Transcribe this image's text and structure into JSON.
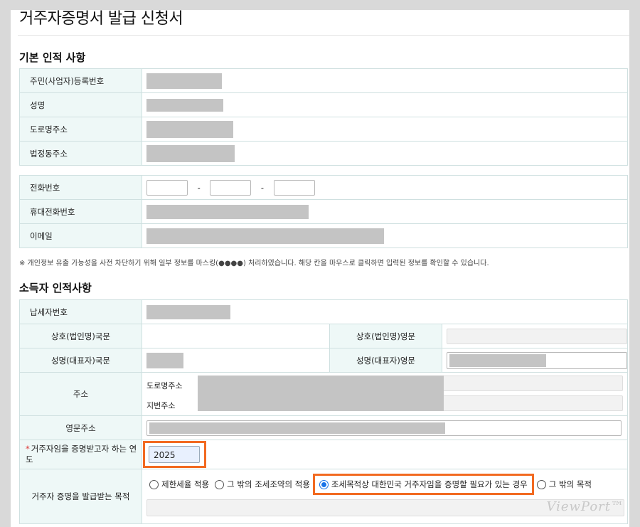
{
  "page": {
    "title": "거주자증명서 발급 신청서"
  },
  "basic_info": {
    "section_title": "기본 인적 사항",
    "fields": [
      {
        "label": "주민(사업자)등록번호"
      },
      {
        "label": "성명"
      },
      {
        "label": "도로명주소"
      },
      {
        "label": "법정동주소"
      }
    ],
    "contact": [
      {
        "label": "전화번호"
      },
      {
        "label": "휴대전화번호"
      },
      {
        "label": "이메일"
      }
    ],
    "dash": "-",
    "note": "※ 개인정보 유출 가능성을 사전 차단하기 위해 일부 정보를 마스킹(●●●●) 처리하였습니다. 해당 칸을 마우스로 클릭하면 입력된 정보를 확인할 수 있습니다."
  },
  "income_info": {
    "section_title": "소득자 인적사항",
    "taxpayer_no_label": "납세자번호",
    "name_kr_label": "상호(법인명)국문",
    "name_en_label": "상호(법인명)영문",
    "rep_kr_label": "성명(대표자)국문",
    "rep_en_label": "성명(대표자)영문",
    "address_label": "주소",
    "road_addr_label": "도로명주소",
    "lot_addr_label": "지번주소",
    "en_addr_label": "영문주소",
    "year_label": "거주자임을 증명받고자 하는 연도",
    "year_required_mark": "*",
    "year_value": "2025",
    "purpose_label": "거주자 증명을 발급받는 목적",
    "purpose_options": [
      {
        "label": "제한세율 적용",
        "selected": false
      },
      {
        "label": "그 밖의 조세조약의 적용",
        "selected": false
      },
      {
        "label": "조세목적상 대한민국 거주자임을 증명할 필요가 있는 경우",
        "selected": true
      },
      {
        "label": "그 밖의 목적",
        "selected": false
      }
    ]
  },
  "watermark": "ViewPort™",
  "colors": {
    "highlight": "#f26a21",
    "label_bg": "#eef8f7",
    "mask": "#c4c4c4",
    "radio_selected": "#1a73e8"
  }
}
